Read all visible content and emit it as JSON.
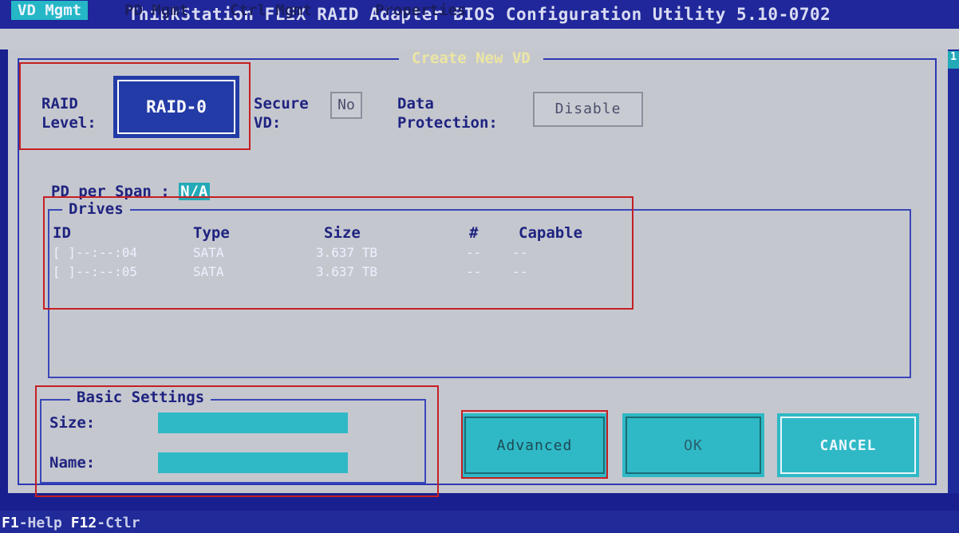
{
  "title": "ThinkStation FLEX RAID Adapter BIOS Configuration Utility 5.10-0702",
  "menu": [
    "VD Mgmt",
    "PD Mgmt",
    "Ctrl Mgmt",
    "Properties"
  ],
  "panel_title": "Create New VD",
  "scroll_indicator": "1",
  "raid_level": {
    "label_line1": "RAID",
    "label_line2": "Level:",
    "value": "RAID-0"
  },
  "secure_vd": {
    "label_line1": "Secure",
    "label_line2": "VD:",
    "value": "No"
  },
  "data_protection": {
    "label_line1": "Data",
    "label_line2": "Protection:",
    "value": "Disable"
  },
  "pd_per_span": {
    "label": "PD per Span :",
    "value": "N/A"
  },
  "drives": {
    "legend": "Drives",
    "columns": {
      "id": "ID",
      "type": "Type",
      "size": "Size",
      "hash": "#",
      "capable": "Capable"
    },
    "rows": [
      {
        "id": "[ ]--:--:04",
        "type": "SATA",
        "size": "3.637 TB",
        "hash": "--",
        "capable": "--"
      },
      {
        "id": "[ ]--:--:05",
        "type": "SATA",
        "size": "3.637 TB",
        "hash": "--",
        "capable": "--"
      }
    ]
  },
  "basic_settings": {
    "legend": "Basic Settings",
    "size_label": "Size:",
    "name_label": "Name:",
    "size_value": "",
    "name_value": ""
  },
  "buttons": {
    "advanced": "Advanced",
    "ok": "OK",
    "cancel": "CANCEL"
  },
  "status_bar": {
    "f1_key": "F1",
    "f1_text": "-Help ",
    "f12_key": "F12",
    "f12_text": "-Ctlr"
  },
  "colors": {
    "background": "#1a1f8f",
    "panel": "#c5c7cf",
    "accent_cyan": "#2fb9c6",
    "highlight_red": "#c51f22",
    "title_yellow": "#ece6a3"
  }
}
